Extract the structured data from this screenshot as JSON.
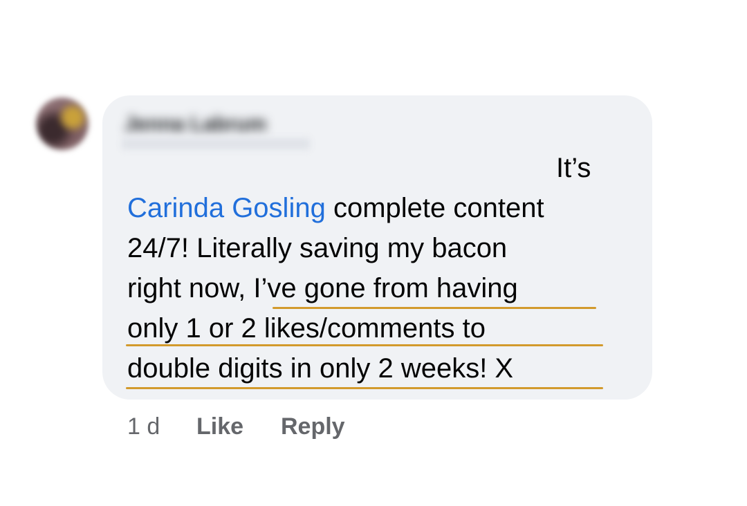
{
  "comment": {
    "author": "Jenna Labrum",
    "text": {
      "line1": "It’s",
      "mention": "Carinda Gosling",
      "line2_rest": " complete content",
      "line3": "24/7! Literally saving my bacon",
      "line4_start": "right now, ",
      "line4_highlight": "I’ve gone from having",
      "line5": "only 1 or 2 likes/comments to",
      "line6": "double digits in only 2 weeks! X"
    },
    "highlight_color": "#d29a2c",
    "mention_color": "#216fdb"
  },
  "actions": {
    "timestamp": "1 d",
    "like_label": "Like",
    "reply_label": "Reply"
  }
}
